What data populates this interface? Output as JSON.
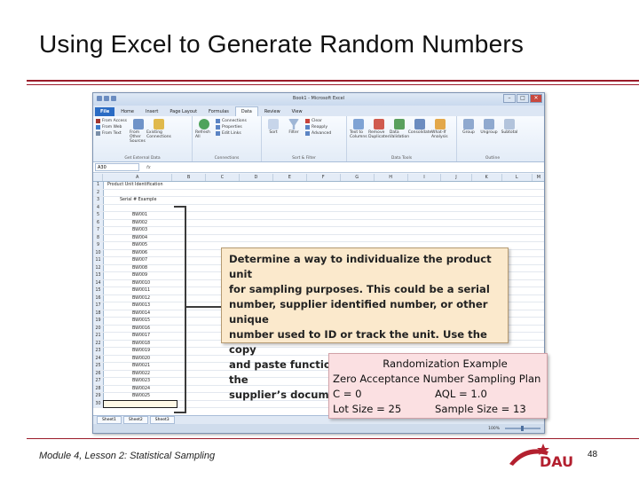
{
  "slide": {
    "title": "Using Excel to Generate Random Numbers",
    "footer": "Module 4, Lesson 2: Statistical Sampling",
    "page_number": "48",
    "logo_text": "DAU",
    "accent_color": "#9b1b2a"
  },
  "excel": {
    "window_title": "Book1 - Microsoft Excel",
    "tabs": [
      "File",
      "Home",
      "Insert",
      "Page Layout",
      "Formulas",
      "Data",
      "Review",
      "View"
    ],
    "active_tab": "Data",
    "ribbon": {
      "get_external_data": {
        "items": [
          "From Access",
          "From Web",
          "From Text"
        ],
        "other": "From Other Sources",
        "existing": "Existing Connections",
        "label": "Get External Data"
      },
      "connections": {
        "refresh": "Refresh All",
        "items": [
          "Connections",
          "Properties",
          "Edit Links"
        ],
        "label": "Connections"
      },
      "sort_filter": {
        "sort": "Sort",
        "filter": "Filter",
        "items": [
          "Clear",
          "Reapply",
          "Advanced"
        ],
        "label": "Sort & Filter"
      },
      "data_tools": {
        "items": [
          "Text to Columns",
          "Remove Duplicates",
          "Data Validation",
          "Consolidate",
          "What-If Analysis"
        ],
        "label": "Data Tools"
      },
      "outline": {
        "items": [
          "Group",
          "Ungroup",
          "Subtotal"
        ],
        "label": "Outline"
      }
    },
    "name_box": "A30",
    "fx": "fx",
    "columns": [
      "A",
      "B",
      "C",
      "D",
      "E",
      "F",
      "G",
      "H",
      "I",
      "J",
      "K",
      "L",
      "M"
    ],
    "rows": [
      {
        "n": "1",
        "a": "Product Unit Identification"
      },
      {
        "n": "2",
        "a": ""
      },
      {
        "n": "3",
        "a": "Serial # Example"
      },
      {
        "n": "4",
        "a": ""
      },
      {
        "n": "5",
        "a": "BW001"
      },
      {
        "n": "6",
        "a": "BW002"
      },
      {
        "n": "7",
        "a": "BW003"
      },
      {
        "n": "8",
        "a": "BW004"
      },
      {
        "n": "9",
        "a": "BW005"
      },
      {
        "n": "10",
        "a": "BW006"
      },
      {
        "n": "11",
        "a": "BW007"
      },
      {
        "n": "12",
        "a": "BW008"
      },
      {
        "n": "13",
        "a": "BW009"
      },
      {
        "n": "14",
        "a": "BW0010"
      },
      {
        "n": "15",
        "a": "BW0011"
      },
      {
        "n": "16",
        "a": "BW0012"
      },
      {
        "n": "17",
        "a": "BW0013"
      },
      {
        "n": "18",
        "a": "BW0014"
      },
      {
        "n": "19",
        "a": "BW0015"
      },
      {
        "n": "20",
        "a": "BW0016"
      },
      {
        "n": "21",
        "a": "BW0017"
      },
      {
        "n": "22",
        "a": "BW0018"
      },
      {
        "n": "23",
        "a": "BW0019"
      },
      {
        "n": "24",
        "a": "BW0020"
      },
      {
        "n": "25",
        "a": "BW0021"
      },
      {
        "n": "26",
        "a": "BW0022"
      },
      {
        "n": "27",
        "a": "BW0023"
      },
      {
        "n": "28",
        "a": "BW0024"
      },
      {
        "n": "29",
        "a": "BW0025"
      },
      {
        "n": "30",
        "a": ""
      }
    ],
    "sheet_tabs": [
      "Sheet1",
      "Sheet2",
      "Sheet3"
    ],
    "zoom": "100%"
  },
  "callout": {
    "text_lines": [
      "Determine a way to individualize the product unit",
      "for sampling purposes. This could be a serial",
      "number, supplier identified number, or other unique",
      "number used to ID or track the unit. Use the copy",
      "and paste function to import information from the",
      "supplier’s documentation."
    ]
  },
  "random_box": {
    "title": "Randomization Example",
    "subtitle": "Zero Acceptance Number Sampling Plan",
    "c_label": "C = 0",
    "aql_label": "AQL = 1.0",
    "lot_label": "Lot Size = 25",
    "sample_label": "Sample Size = 13"
  }
}
